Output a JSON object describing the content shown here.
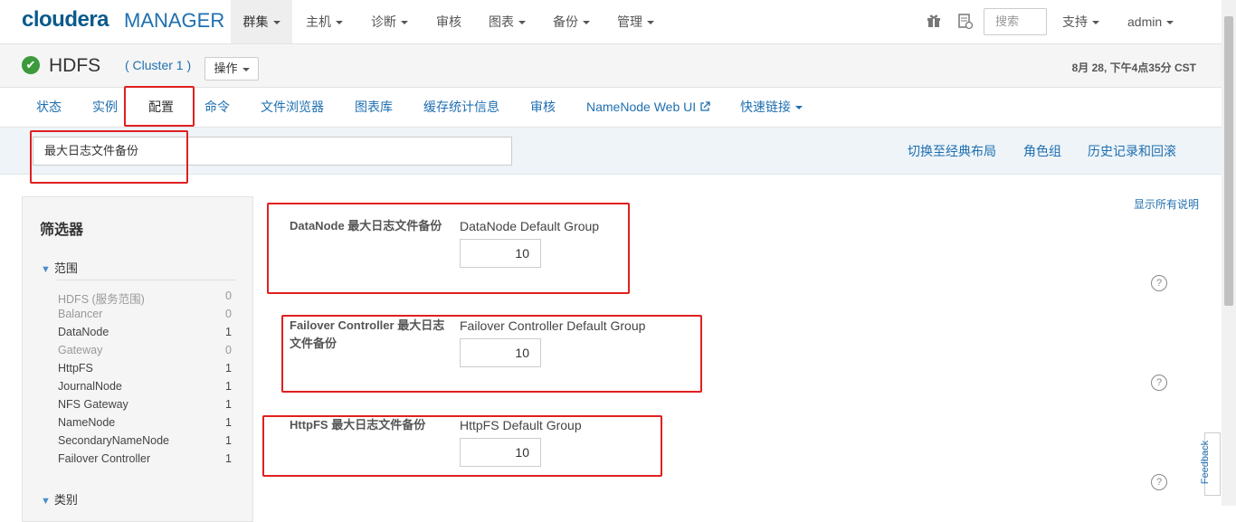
{
  "app": {
    "logo_primary": "cloudera",
    "logo_secondary": "MANAGER"
  },
  "topnav": {
    "items": [
      {
        "label": "群集",
        "dropdown": true,
        "active": true
      },
      {
        "label": "主机",
        "dropdown": true
      },
      {
        "label": "诊断",
        "dropdown": true
      },
      {
        "label": "审核",
        "dropdown": false
      },
      {
        "label": "图表",
        "dropdown": true
      },
      {
        "label": "备份",
        "dropdown": true
      },
      {
        "label": "管理",
        "dropdown": true
      }
    ],
    "search_placeholder": "搜索",
    "support_label": "支持",
    "user_label": "admin",
    "icons": [
      "gift-icon",
      "running-commands-icon"
    ]
  },
  "service": {
    "name": "HDFS",
    "cluster": "( Cluster 1 )",
    "actions_label": "操作",
    "status": "good-health",
    "datetime": "8月 28, 下午4点35分 CST"
  },
  "tabs": [
    {
      "label": "状态"
    },
    {
      "label": "实例"
    },
    {
      "label": "配置",
      "active": true
    },
    {
      "label": "命令"
    },
    {
      "label": "文件浏览器"
    },
    {
      "label": "图表库"
    },
    {
      "label": "缓存统计信息"
    },
    {
      "label": "审核"
    },
    {
      "label": "NameNode Web UI",
      "external": true
    },
    {
      "label": "快速链接",
      "dropdown": true
    }
  ],
  "filterbar": {
    "search_value": "最大日志文件备份",
    "links": [
      "切换至经典布局",
      "角色组",
      "历史记录和回滚"
    ]
  },
  "sidebar": {
    "title": "筛选器",
    "section_scope": "范围",
    "scope_items": [
      {
        "name": "HDFS (服务范围)",
        "count": "0"
      },
      {
        "name": "Balancer",
        "count": "0"
      },
      {
        "name": "DataNode",
        "count": "1"
      },
      {
        "name": "Gateway",
        "count": "0"
      },
      {
        "name": "HttpFS",
        "count": "1"
      },
      {
        "name": "JournalNode",
        "count": "1"
      },
      {
        "name": "NFS Gateway",
        "count": "1"
      },
      {
        "name": "NameNode",
        "count": "1"
      },
      {
        "name": "SecondaryNameNode",
        "count": "1"
      },
      {
        "name": "Failover Controller",
        "count": "1"
      }
    ],
    "section_category": "类别"
  },
  "main": {
    "show_all_desc": "显示所有说明",
    "configs": [
      {
        "label": "DataNode 最大日志文件备份",
        "group": "DataNode Default Group",
        "value": "10"
      },
      {
        "label": "Failover Controller 最大日志文件备份",
        "group": "Failover Controller Default Group",
        "value": "10"
      },
      {
        "label": "HttpFS 最大日志文件备份",
        "group": "HttpFS Default Group",
        "value": "10"
      }
    ]
  },
  "feedback_label": "Feedback",
  "colors": {
    "link": "#1f6fb0",
    "highlight": "#e02020",
    "status_ok": "#3c9a3c"
  }
}
